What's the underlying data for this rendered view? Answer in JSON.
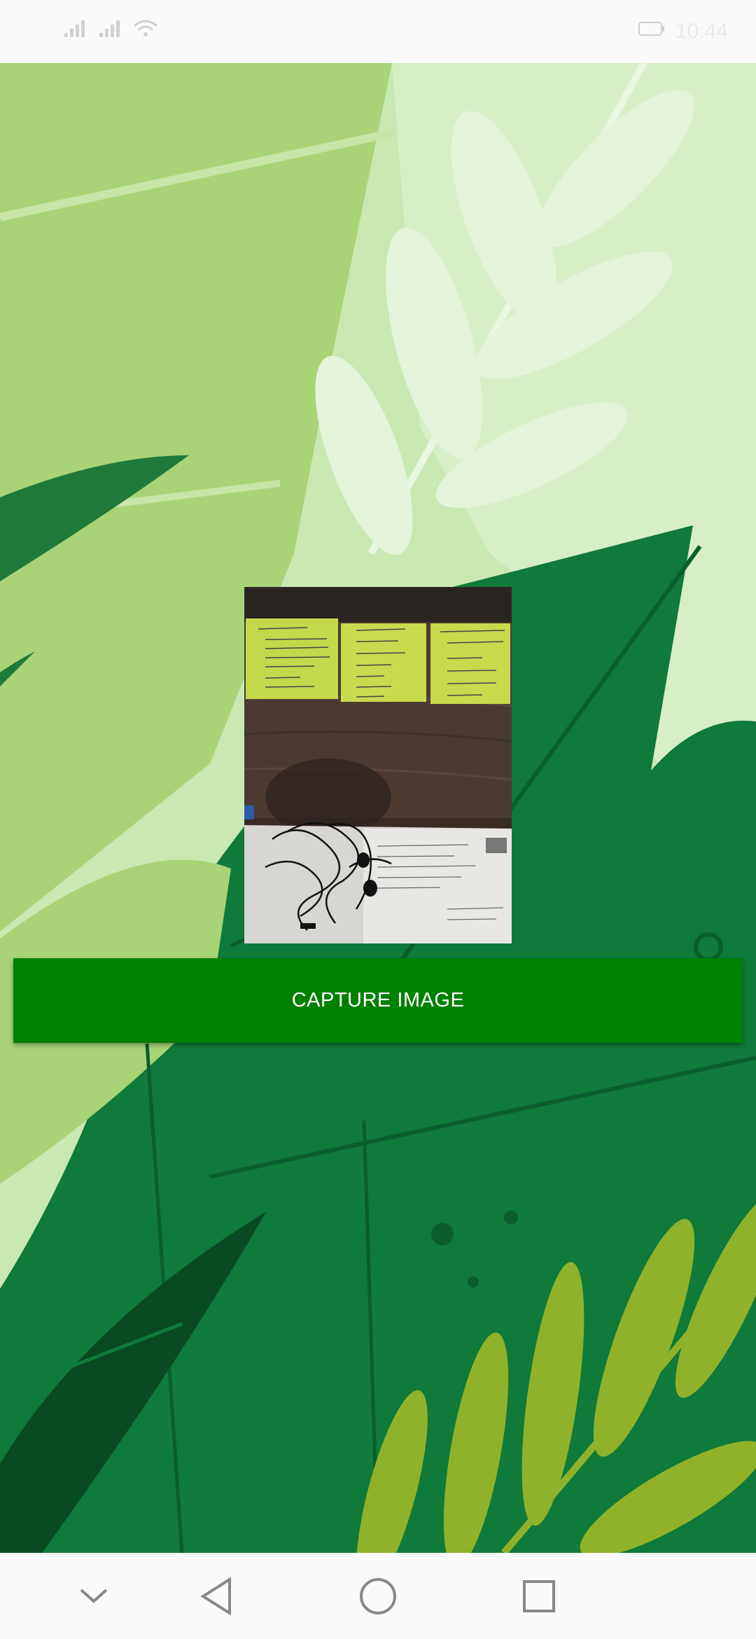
{
  "status_bar": {
    "time": "10:44",
    "battery": "battery-icon",
    "signal": "signal-icon",
    "wifi": "wifi-icon"
  },
  "background": {
    "icon": "leaf-pattern-background",
    "colors": {
      "light_green": "#c8e6b0",
      "mid_green": "#a6d173",
      "dark_green": "#0f7a3a",
      "deep_green": "#0b5e2e",
      "olive": "#8fb22a"
    }
  },
  "photo": {
    "icon": "captured-photo",
    "alt": "captured-image-preview"
  },
  "actions": {
    "capture_label": "CAPTURE IMAGE",
    "button_color": "#008000"
  },
  "nav": {
    "hide_icon": "chevron-down-icon",
    "back_icon": "back-triangle-icon",
    "home_icon": "home-circle-icon",
    "recents_icon": "recents-square-icon"
  }
}
